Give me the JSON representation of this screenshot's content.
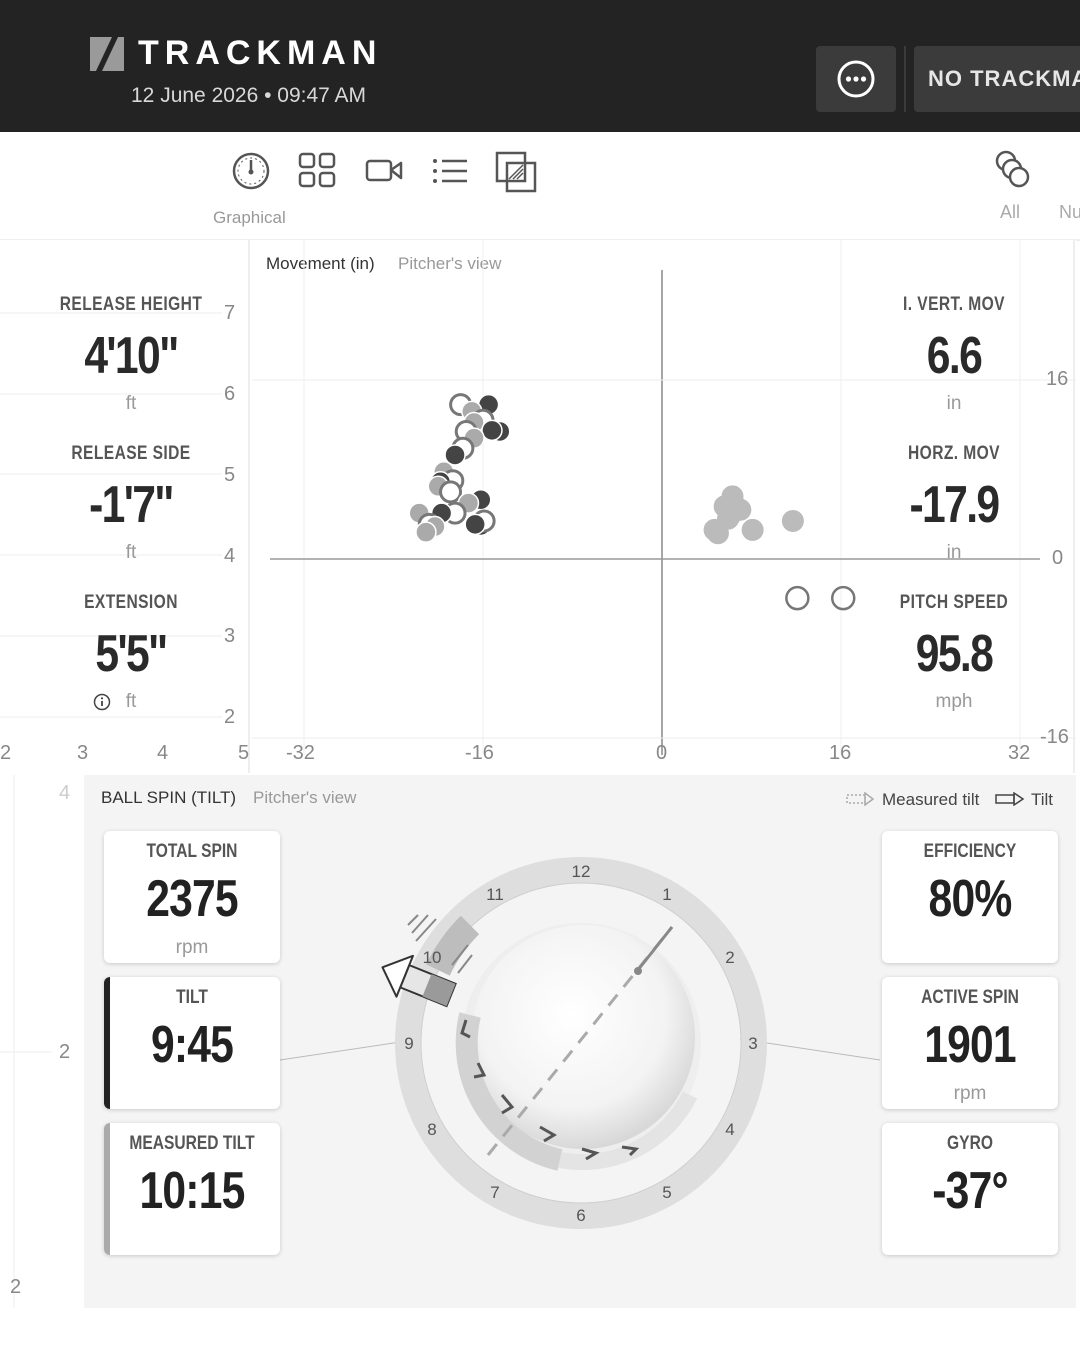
{
  "header": {
    "brand": "TRACKMAN",
    "datetime": "12 June 2026 • 09:47 AM",
    "more_icon": "more-dots-icon",
    "status_button": "NO TRACKMAN"
  },
  "toolbar": {
    "tools": [
      "gauge-icon",
      "grid-icon",
      "video-icon",
      "list-icon",
      "overlay-icon"
    ],
    "graphical_label": "Graphical",
    "filter_icon": "balls-filter-icon",
    "all_label": "All",
    "nu_label": "Nu"
  },
  "release": {
    "height": {
      "title": "RELEASE HEIGHT",
      "value": "4'10\"",
      "unit": "ft"
    },
    "side": {
      "title": "RELEASE SIDE",
      "value": "-1'7\"",
      "unit": "ft"
    },
    "extension": {
      "title": "EXTENSION",
      "value": "5'5\"",
      "unit": "ft"
    },
    "y_ticks": [
      "7",
      "6",
      "5",
      "4",
      "3",
      "2"
    ],
    "x_ticks": [
      "2",
      "3",
      "4",
      "5"
    ]
  },
  "movement": {
    "title": "Movement (in)",
    "view": "Pitcher's view",
    "x_ticks": [
      "-32",
      "-16",
      "0",
      "16",
      "32"
    ],
    "y_ticks": [
      "16",
      "0",
      "-16"
    ],
    "vert": {
      "title": "I. VERT. MOV",
      "value": "6.6",
      "unit": "in"
    },
    "horz": {
      "title": "HORZ. MOV",
      "value": "-17.9",
      "unit": "in"
    },
    "speed": {
      "title": "PITCH SPEED",
      "value": "95.8",
      "unit": "mph"
    }
  },
  "chart_data": {
    "type": "scatter",
    "title": "Movement (in)",
    "xlim": [
      -32,
      32
    ],
    "ylim": [
      -16,
      16
    ],
    "series": [
      {
        "values": [
          [
            -18,
            13.8
          ],
          [
            -15.5,
            13.8
          ],
          [
            -17,
            13.2
          ],
          [
            -16,
            12.4
          ],
          [
            -14.5,
            11.4
          ],
          [
            -16.8,
            12.2
          ],
          [
            -17.5,
            11.4
          ],
          [
            -15.2,
            11.5
          ],
          [
            -16.8,
            10.8
          ],
          [
            -17.8,
            9.9
          ],
          [
            -18.5,
            9.3
          ],
          [
            -19.5,
            7.8
          ],
          [
            -18.7,
            7.0
          ],
          [
            -19.8,
            6.9
          ],
          [
            -20,
            6.5
          ],
          [
            -18.9,
            6.0
          ],
          [
            -16.2,
            5.3
          ],
          [
            -17.3,
            5.0
          ],
          [
            -18.5,
            4.1
          ],
          [
            -19.7,
            4.1
          ],
          [
            -21.7,
            4.1
          ],
          [
            -20.8,
            3.1
          ],
          [
            -16.2,
            3.0
          ],
          [
            -20.3,
            2.9
          ],
          [
            -15.9,
            3.4
          ],
          [
            -16.7,
            3.1
          ],
          [
            -21.1,
            2.4
          ]
        ]
      },
      {
        "values": [
          [
            6.3,
            5.6
          ],
          [
            6.5,
            4.8
          ],
          [
            6.1,
            3.9
          ],
          [
            5.9,
            3.6
          ],
          [
            5.6,
            4.7
          ],
          [
            7.0,
            4.4
          ],
          [
            5.0,
            2.3
          ],
          [
            4.7,
            2.6
          ],
          [
            8.1,
            2.6
          ],
          [
            11.7,
            3.4
          ]
        ]
      },
      {
        "values": [
          [
            12.1,
            -3.5
          ],
          [
            16.2,
            -3.5
          ]
        ]
      }
    ]
  },
  "spin": {
    "title": "BALL SPIN (TILT)",
    "view": "Pitcher's view",
    "legend_measured": "Measured tilt",
    "legend_tilt": "Tilt",
    "left_ticks": [
      "4",
      "2",
      "2"
    ],
    "clock_numbers": [
      "12",
      "1",
      "2",
      "3",
      "4",
      "5",
      "6",
      "7",
      "8",
      "9",
      "10",
      "11"
    ],
    "cards_left": [
      {
        "title": "TOTAL SPIN",
        "value": "2375",
        "unit": "rpm"
      },
      {
        "title": "TILT",
        "value": "9:45",
        "unit": ""
      },
      {
        "title": "MEASURED TILT",
        "value": "10:15",
        "unit": ""
      }
    ],
    "cards_right": [
      {
        "title": "EFFICIENCY",
        "value": "80%",
        "unit": ""
      },
      {
        "title": "ACTIVE SPIN",
        "value": "1901",
        "unit": "rpm"
      },
      {
        "title": "GYRO",
        "value": "-37°",
        "unit": ""
      }
    ]
  }
}
